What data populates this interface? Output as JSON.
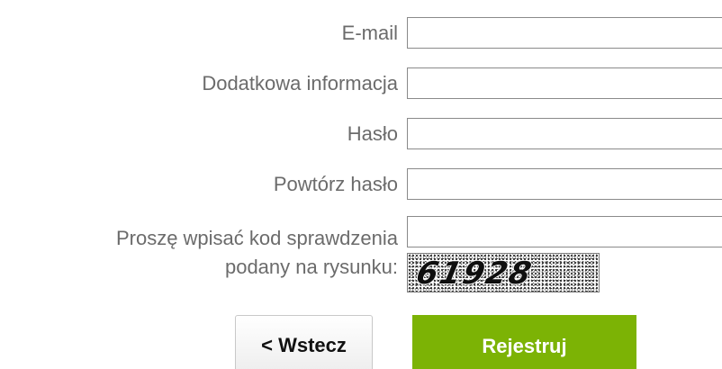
{
  "form": {
    "fields": [
      {
        "label": "E-mail",
        "value": ""
      },
      {
        "label": "Dodatkowa informacja",
        "value": ""
      },
      {
        "label": "Hasło",
        "value": ""
      },
      {
        "label": "Powtórz hasło",
        "value": ""
      },
      {
        "label_line1": "Proszę wpisać kod sprawdzenia",
        "label_line2": "podany na rysunku:",
        "value": ""
      }
    ],
    "captcha_text": "61928",
    "back_label": "< Wstecz",
    "register_label": "Rejestruj"
  },
  "colors": {
    "label_text": "#6b6b6b",
    "register_bg": "#7cb305",
    "field_border": "#8a8a8a"
  }
}
